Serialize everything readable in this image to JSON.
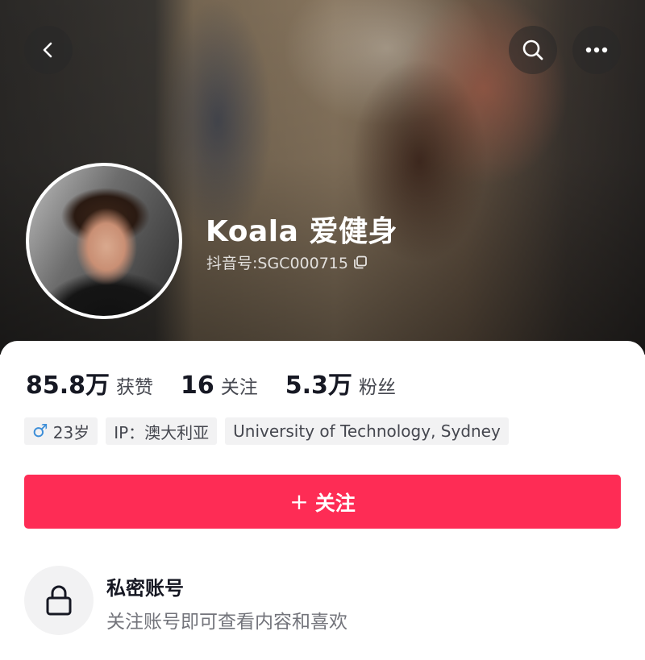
{
  "profile": {
    "name": "Koala 爱健身",
    "douyin_id": "抖音号:SGC000715"
  },
  "stats": [
    {
      "value": "85.8万",
      "label": "获赞"
    },
    {
      "value": "16",
      "label": "关注"
    },
    {
      "value": "5.3万",
      "label": "粉丝"
    }
  ],
  "tags": {
    "gender_symbol": "♂",
    "age": "23岁",
    "ip": "IP：澳大利亚",
    "school": "University of Technology, Sydney"
  },
  "follow_button": {
    "plus": "+",
    "label": "关注"
  },
  "private": {
    "title": "私密账号",
    "description": "关注账号即可查看内容和喜欢"
  },
  "colors": {
    "accent": "#fe2c55",
    "gender_male": "#3d8ed8"
  },
  "icons": {
    "back": "back-arrow-icon",
    "search": "search-icon",
    "more": "more-icon",
    "copy": "copy-icon",
    "lock": "lock-icon"
  }
}
